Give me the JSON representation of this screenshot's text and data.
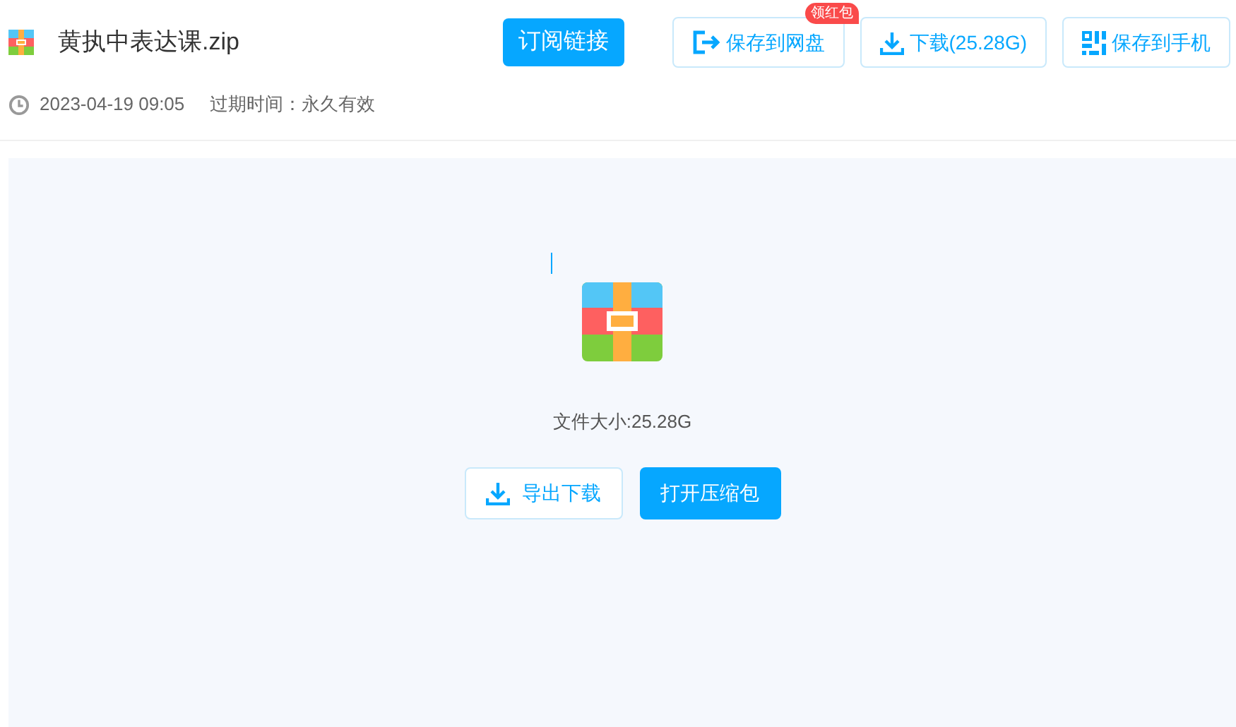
{
  "file": {
    "name": "黄执中表达课.zip"
  },
  "subscribe_button": "订阅链接",
  "actions": [
    {
      "kind": "save",
      "label": "保存到网盘",
      "badge": "领红包"
    },
    {
      "kind": "download",
      "label": "下载(25.28G)"
    },
    {
      "kind": "phone",
      "label": "保存到手机"
    }
  ],
  "meta": {
    "date": "2023-04-19 09:05",
    "expiry": "过期时间：永久有效"
  },
  "preview": {
    "size": "文件大小:25.28G",
    "buttons": [
      {
        "kind": "export",
        "label": "导出下载"
      },
      {
        "kind": "open",
        "label": "打开压缩包"
      }
    ]
  }
}
